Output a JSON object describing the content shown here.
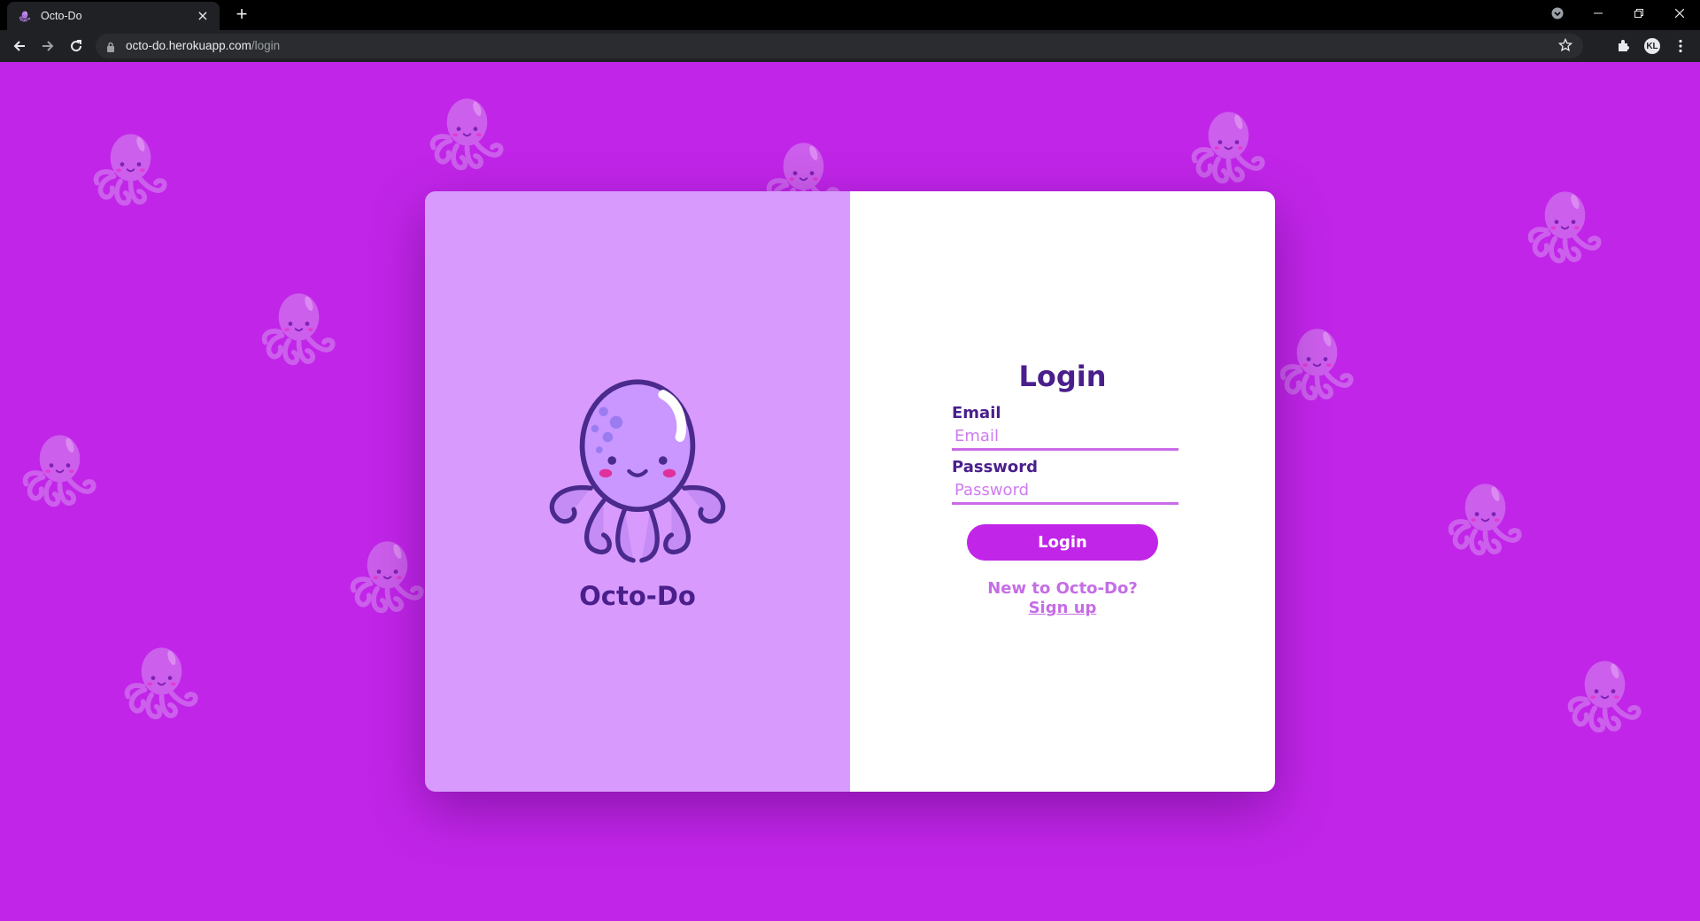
{
  "browser": {
    "tab_title": "Octo-Do",
    "url_host": "octo-do.herokuapp.com",
    "url_path": "/login",
    "profile_initials": "KL"
  },
  "brand": {
    "name": "Octo-Do"
  },
  "login": {
    "title": "Login",
    "email_label": "Email",
    "email_placeholder": "Email",
    "password_label": "Password",
    "password_placeholder": "Password",
    "submit_label": "Login",
    "new_user_text": "New to Octo-Do?",
    "signup_link": "Sign up"
  },
  "colors": {
    "background": "#c125e8",
    "panel_left": "#d89bfd",
    "accent_dark": "#4a1f8c",
    "accent_light": "#c56de6"
  }
}
